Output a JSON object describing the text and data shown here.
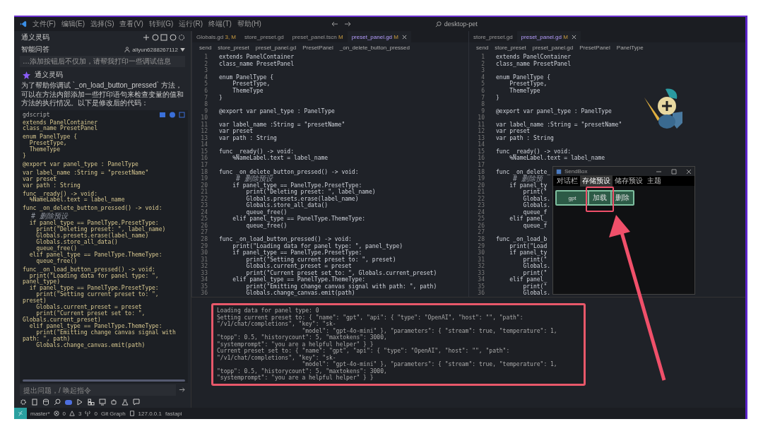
{
  "title_bar": {
    "menus": [
      "文件(F)",
      "编辑(E)",
      "选择(S)",
      "查看(V)",
      "转到(G)",
      "运行(R)",
      "终端(T)",
      "帮助(H)"
    ],
    "search": "desktop-pet"
  },
  "chat": {
    "title": "通义灵码",
    "section": "智能问答",
    "user": "aliyun6288267112",
    "previous_message": "…添加按钮后不仅加，请帮我打印一些调试信息",
    "assistant": "通义灵码",
    "answer": "为了帮助你调试 `_on_load_button_pressed` 方法，可以在方法内部添加一些打印语句来检查变量的值和方法的执行情况。以下是修改后的代码：",
    "code_language": "gdscript",
    "code_blocks": [
      [
        "extends PanelContainer",
        "class_name PresetPanel"
      ],
      [
        "enum PanelType {",
        "  PresetType,",
        "  ThemeType",
        "}"
      ],
      [
        "@export var panel_type : PanelType"
      ],
      [
        "var label_name :String = \"presetName\"",
        "var preset",
        "var path : String"
      ],
      [
        "func _ready() -> void:",
        "  %NameLabel.text = label_name"
      ],
      [
        "func _on_delete_button_pressed() -> void:",
        {
          "text": "  # 删除预设",
          "kind": "comment"
        },
        "  if panel_type == PanelType.PresetType:",
        "    print(\"Deleting preset: \", label_name)",
        "    Globals.presets.erase(label_name)",
        "    Globals.store_all_data()",
        "    queue_free()",
        "  elif panel_type == PanelType.ThemeType:",
        "    queue_free()"
      ],
      [
        "func _on_load_button_pressed() -> void:",
        "  print(\"Loading data for panel type: \", panel_type)",
        "  if panel_type == PanelType.PresetType:",
        "    print(\"Setting current preset to: \", preset)",
        "    Globals.current_preset = preset",
        "    print(\"Current preset set to: \", Globals.current_preset)",
        "  elif panel_type == PanelType.ThemeType:",
        "    print(\"Emitting change canvas signal with path: \", path)",
        "    Globals.change_canvas.emit(path)"
      ]
    ],
    "input_placeholder": "提出问题，/ 唤起指令"
  },
  "editors": [
    {
      "tabs": [
        {
          "label": "Globals.gd",
          "badge": "3, M",
          "selected": false
        },
        {
          "label": "store_preset.gd",
          "selected": false
        },
        {
          "label": "preset_panel.tscn",
          "badge": "M",
          "selected": false
        },
        {
          "label": "preset_panel.gd",
          "badge": "M",
          "selected": true
        }
      ],
      "breadcrumb": [
        "send",
        "store_preset",
        "preset_panel.gd",
        "PresetPanel",
        "_on_delete_button_pressed"
      ],
      "lines": [
        {
          "n": "1",
          "text": "extends PanelContainer"
        },
        {
          "n": "2",
          "text": "class_name PresetPanel"
        },
        {
          "n": "3"
        },
        {
          "n": "4",
          "text": "enum PanelType {"
        },
        {
          "n": "5",
          "text": "    PresetType,"
        },
        {
          "n": "6",
          "text": "    ThemeType"
        },
        {
          "n": "7",
          "text": "}"
        },
        {
          "n": "8"
        },
        {
          "n": "9",
          "text": "@export var panel_type : PanelType"
        },
        {
          "n": "10"
        },
        {
          "n": "11",
          "text": "var label_name :String = \"presetName\""
        },
        {
          "n": "12",
          "text": "var preset"
        },
        {
          "n": "13",
          "text": "var path : String"
        },
        {
          "n": "14"
        },
        {
          "n": "15",
          "text": "func _ready() -> void:"
        },
        {
          "n": "16",
          "text": "    %NameLabel.text = label_name"
        },
        {
          "n": "17"
        },
        {
          "n": "18",
          "text": "func _on_delete_button_pressed() -> void:"
        },
        {
          "n": "19",
          "text": "    # 删除预设",
          "kind": "comment"
        },
        {
          "n": "20",
          "text": "    if panel_type == PanelType.PresetType:"
        },
        {
          "n": "21",
          "text": "        print(\"Deleting preset: \", label_name)"
        },
        {
          "n": "22",
          "text": "        Globals.presets.erase(label_name)"
        },
        {
          "n": "23",
          "text": "        Globals.store_all_data()"
        },
        {
          "n": "24",
          "text": "        queue_free()"
        },
        {
          "n": "25",
          "text": "    elif panel_type == PanelType.ThemeType:"
        },
        {
          "n": "26",
          "text": "        queue_free()"
        },
        {
          "n": "27"
        },
        {
          "n": "28",
          "text": "func _on_load_button_pressed() -> void:"
        },
        {
          "n": "29",
          "text": "    print(\"Loading data for panel type: \", panel_type)"
        },
        {
          "n": "30",
          "text": "    if panel_type == PanelType.PresetType:"
        },
        {
          "n": "31",
          "text": "        print(\"Setting current preset to: \", preset)"
        },
        {
          "n": "32",
          "text": "        Globals.current_preset = preset"
        },
        {
          "n": "33",
          "text": "        print(\"Current preset set to: \", Globals.current_preset)"
        },
        {
          "n": "34",
          "text": "    elif panel_type == PanelType.ThemeType:"
        },
        {
          "n": "35",
          "text": "        print(\"Emitting change canvas signal with path: \", path)"
        },
        {
          "n": "36",
          "text": "        Globals.change_canvas.emit(path)"
        }
      ]
    },
    {
      "tabs": [
        {
          "label": "store_preset.gd",
          "selected": false
        },
        {
          "label": "preset_panel.gd",
          "badge": "M",
          "selected": true
        }
      ],
      "breadcrumb": [
        "send",
        "store_preset",
        "preset_panel.gd",
        "PresetPanel",
        "PanelType"
      ],
      "lines": [
        {
          "n": "1",
          "text": "extends PanelContainer"
        },
        {
          "n": "2",
          "text": "class_name PresetPanel"
        },
        {
          "n": "3"
        },
        {
          "n": "4",
          "text": "enum PanelType {"
        },
        {
          "n": "5",
          "text": "    PresetType,"
        },
        {
          "n": "6",
          "text": "    ThemeType"
        },
        {
          "n": "7",
          "text": "}"
        },
        {
          "n": "8"
        },
        {
          "n": "9",
          "text": "@export var panel_type : PanelType"
        },
        {
          "n": "10"
        },
        {
          "n": "11",
          "text": "var label_name :String = \"presetName\""
        },
        {
          "n": "12",
          "text": "var preset"
        },
        {
          "n": "13",
          "text": "var path : String"
        },
        {
          "n": "14"
        },
        {
          "n": "15",
          "text": "func _ready() -> void:"
        },
        {
          "n": "16",
          "text": "    %NameLabel.text = label_name"
        },
        {
          "n": "17"
        },
        {
          "n": "18",
          "text": "func _on_delete_"
        },
        {
          "n": "19",
          "text": "    # 删除预",
          "kind": "comment"
        },
        {
          "n": "20",
          "text": "    if panel_ty"
        },
        {
          "n": "21",
          "text": "        print(\""
        },
        {
          "n": "22",
          "text": "        Globals."
        },
        {
          "n": "23",
          "text": "        Globals."
        },
        {
          "n": "24",
          "text": "        queue_f"
        },
        {
          "n": "25",
          "text": "    elif panel_"
        },
        {
          "n": "26",
          "text": "        queue_f"
        },
        {
          "n": "27"
        },
        {
          "n": "28",
          "text": "func _on_load_b"
        },
        {
          "n": "29",
          "text": "    print(\"Load"
        },
        {
          "n": "30",
          "text": "    if panel_ty"
        },
        {
          "n": "31",
          "text": "        print(\""
        },
        {
          "n": "32",
          "text": "        Globals."
        },
        {
          "n": "33",
          "text": "        print(\""
        },
        {
          "n": "34",
          "text": "    elif panel_"
        },
        {
          "n": "35",
          "text": "        print(\""
        },
        {
          "n": "36",
          "text": "        Globals."
        }
      ]
    }
  ],
  "output": [
    "Loading data for panel type: 0",
    "Setting current preset to: { \"name\": \"gpt\", \"api\": { \"type\": \"OpenAI\", \"host\": \"\", \"path\": \"/v1/chat/completions\", \"key\": \"sk-",
    "                         \"model\": \"gpt-4o-mini\" }, \"parameters\": { \"stream\": true, \"temperature\": 1, \"topp\": 0.5, \"historycount\": 5, \"maxtokens\": 3000,",
    "\"systemprompt\": \"you are a helpful helper\" } }",
    "Current preset set to: { \"name\": \"gpt\", \"api\": { \"type\": \"OpenAI\", \"host\": \"\", \"path\": \"/v1/chat/completions\", \"key\": \"sk-",
    "                         \"model\": \"gpt-4o-mini\" }, \"parameters\": { \"stream\": true, \"temperature\": 1, \"topp\": 0.5, \"historycount\": 5, \"maxtokens\": 3000,",
    "\"systemprompt\": \"you are a helpful helper\" } }"
  ],
  "sendbox": {
    "title": "SendBox",
    "tabs": [
      {
        "label": "对话栏",
        "selected": false
      },
      {
        "label": "存储预设",
        "selected": true
      },
      {
        "label": "储存预设",
        "selected": false
      },
      {
        "label": "主题",
        "selected": false
      }
    ],
    "preset": {
      "name": "gpt",
      "buttons": [
        "加载",
        "删除"
      ]
    }
  },
  "status_bar": {
    "branch": "master*",
    "errors": "0",
    "warnings": "3",
    "ports": "0",
    "git_graph": "Git Graph",
    "host": "127.0.0.1",
    "env": "fastapi"
  }
}
